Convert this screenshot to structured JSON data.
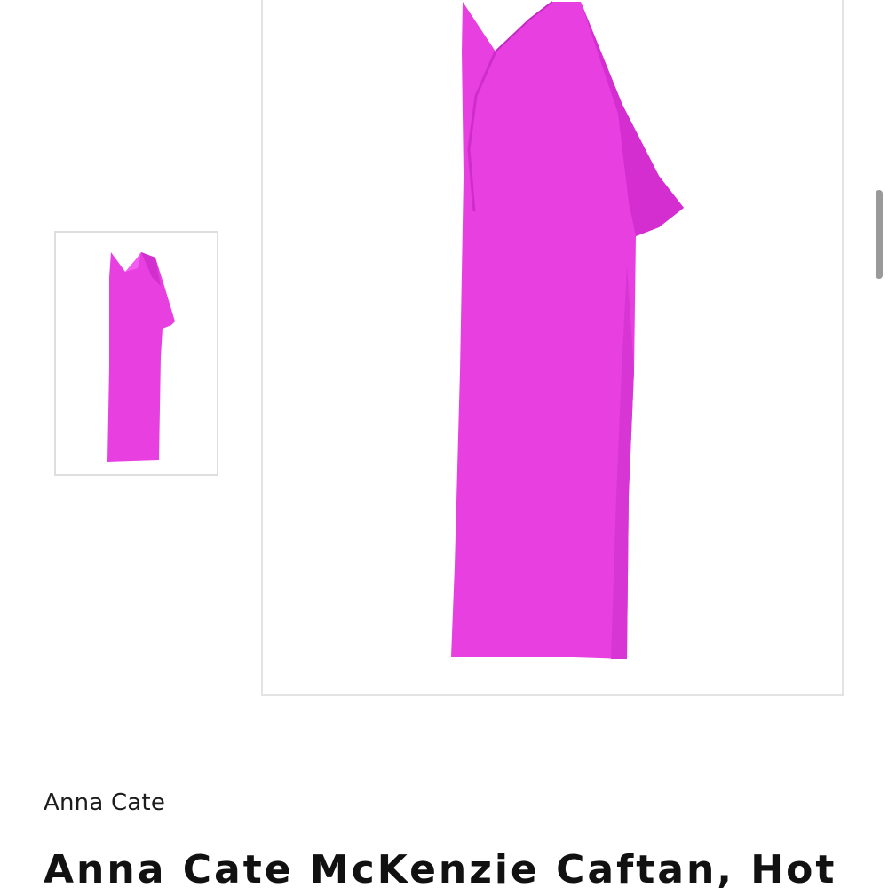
{
  "product": {
    "brand": "Anna Cate",
    "title": "Anna Cate McKenzie Caftan, Hot"
  },
  "gallery": {
    "thumbnail_icon": "dress-thumbnail",
    "main_icon": "dress-main-photo"
  },
  "colors": {
    "dress": "#e83fe0",
    "dress_shade": "#d22fcf",
    "border": "#dedede"
  }
}
